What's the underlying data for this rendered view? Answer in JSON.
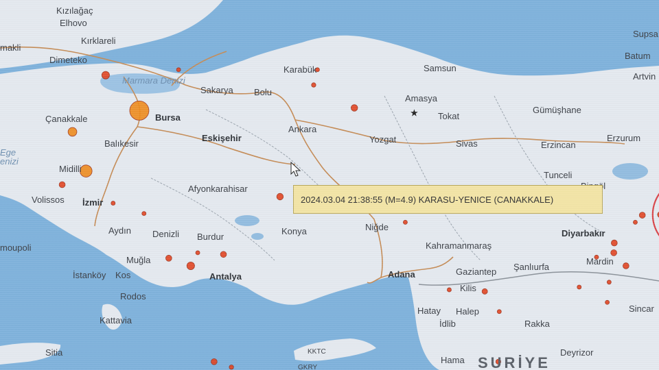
{
  "map": {
    "colors": {
      "sea": "#7fb2dc",
      "land": "#e5eaf0",
      "lake": "#93bde0",
      "road": "#c58b55",
      "border": "#9aa3ad",
      "quake_fill": "#e2421f",
      "quake_large": "#f08a1a",
      "quake_ring": "#d7262a"
    },
    "labels": [
      {
        "id": "kizilagac",
        "text": "Kızılağaç"
      },
      {
        "id": "elhovo",
        "text": "Elhovo"
      },
      {
        "id": "kirklareli",
        "text": "Kırklareli"
      },
      {
        "id": "makli",
        "text": "makli"
      },
      {
        "id": "dimeteko",
        "text": "Dimeteko"
      },
      {
        "id": "marmara",
        "text": "Marmara Denizi"
      },
      {
        "id": "sakarya",
        "text": "Sakarya"
      },
      {
        "id": "bolu",
        "text": "Bolu"
      },
      {
        "id": "karabuk",
        "text": "Karabük"
      },
      {
        "id": "samsun",
        "text": "Samsun"
      },
      {
        "id": "supsa",
        "text": "Supsa"
      },
      {
        "id": "batum",
        "text": "Batum"
      },
      {
        "id": "artvin",
        "text": "Artvin"
      },
      {
        "id": "amasya",
        "text": "Amasya"
      },
      {
        "id": "gumushane",
        "text": "Gümüşhane"
      },
      {
        "id": "canakkale",
        "text": "Çanakkale"
      },
      {
        "id": "bursa",
        "text": "Bursa"
      },
      {
        "id": "tokat",
        "text": "Tokat"
      },
      {
        "id": "ankara",
        "text": "Ankara"
      },
      {
        "id": "balikesir",
        "text": "Balıkesir"
      },
      {
        "id": "eskisehir",
        "text": "Eskişehir"
      },
      {
        "id": "yozgat",
        "text": "Yozgat"
      },
      {
        "id": "sivas",
        "text": "Sivas"
      },
      {
        "id": "erzincan",
        "text": "Erzincan"
      },
      {
        "id": "erzurum",
        "text": "Erzurum"
      },
      {
        "id": "ege",
        "text": "Ege"
      },
      {
        "id": "denizi",
        "text": "enizi"
      },
      {
        "id": "midilli",
        "text": "Midilli"
      },
      {
        "id": "tunceli",
        "text": "Tunceli"
      },
      {
        "id": "bingol",
        "text": "Bingöl"
      },
      {
        "id": "afyon",
        "text": "Afyonkarahisar"
      },
      {
        "id": "volissos",
        "text": "Volissos"
      },
      {
        "id": "izmir",
        "text": "İzmir"
      },
      {
        "id": "nigde",
        "text": "Niğde"
      },
      {
        "id": "aydin",
        "text": "Aydın"
      },
      {
        "id": "denizli",
        "text": "Denizli"
      },
      {
        "id": "burdur",
        "text": "Burdur"
      },
      {
        "id": "konya",
        "text": "Konya"
      },
      {
        "id": "diyarbakir",
        "text": "Diyarbakır"
      },
      {
        "id": "kahramanmaras",
        "text": "Kahramanmaraş"
      },
      {
        "id": "moupoli",
        "text": "moupoli"
      },
      {
        "id": "mardin",
        "text": "Mardin"
      },
      {
        "id": "sanliurfa",
        "text": "Şanlıurfa"
      },
      {
        "id": "mugla",
        "text": "Muğla"
      },
      {
        "id": "gaziantep",
        "text": "Gaziantep"
      },
      {
        "id": "istankoy",
        "text": "İstanköy"
      },
      {
        "id": "kos",
        "text": "Kos"
      },
      {
        "id": "antalya",
        "text": "Antalya"
      },
      {
        "id": "adana",
        "text": "Adana"
      },
      {
        "id": "kilis",
        "text": "Kilis"
      },
      {
        "id": "rodos",
        "text": "Rodos"
      },
      {
        "id": "sincar",
        "text": "Sincar"
      },
      {
        "id": "hatay",
        "text": "Hatay"
      },
      {
        "id": "halep",
        "text": "Halep"
      },
      {
        "id": "kattavia",
        "text": "Kattavia"
      },
      {
        "id": "idlib",
        "text": "İdlib"
      },
      {
        "id": "rakka",
        "text": "Rakka"
      },
      {
        "id": "sitia",
        "text": "Sitia"
      },
      {
        "id": "kktc",
        "text": "KKTC"
      },
      {
        "id": "gkry",
        "text": "GKRY"
      },
      {
        "id": "hama",
        "text": "Hama"
      },
      {
        "id": "suriye",
        "text": "SURİYE"
      },
      {
        "id": "deyrizor",
        "text": "Deyrizor"
      }
    ],
    "earthquakes": [
      {
        "lat": 40.62,
        "lon": 26.26,
        "mag": 2.8
      },
      {
        "lat": 39.97,
        "lon": 26.98,
        "mag": 4.9,
        "selected": true
      },
      {
        "lat": 40.72,
        "lon": 27.82,
        "mag": 2.0
      },
      {
        "lat": 39.58,
        "lon": 25.55,
        "mag": 3.0
      },
      {
        "lat": 38.86,
        "lon": 25.84,
        "mag": 3.6
      },
      {
        "lat": 38.61,
        "lon": 25.33,
        "mag": 2.5
      },
      {
        "lat": 38.27,
        "lon": 26.42,
        "mag": 2.0
      },
      {
        "lat": 38.08,
        "lon": 27.08,
        "mag": 2.0
      },
      {
        "lat": 37.26,
        "lon": 27.61,
        "mag": 2.5
      },
      {
        "lat": 37.12,
        "lon": 28.08,
        "mag": 2.8
      },
      {
        "lat": 37.36,
        "lon": 28.23,
        "mag": 2.0
      },
      {
        "lat": 37.33,
        "lon": 28.78,
        "mag": 2.5
      },
      {
        "lat": 38.39,
        "lon": 29.99,
        "mag": 2.6
      },
      {
        "lat": 40.44,
        "lon": 30.71,
        "mag": 2.2
      },
      {
        "lat": 40.72,
        "lon": 30.79,
        "mag": 2.0
      },
      {
        "lat": 40.02,
        "lon": 31.58,
        "mag": 2.6
      },
      {
        "lat": 37.92,
        "lon": 32.67,
        "mag": 2.0
      },
      {
        "lat": 36.68,
        "lon": 33.61,
        "mag": 2.0
      },
      {
        "lat": 36.65,
        "lon": 34.37,
        "mag": 2.4
      },
      {
        "lat": 36.28,
        "lon": 34.68,
        "mag": 2.0
      },
      {
        "lat": 35.36,
        "lon": 34.66,
        "mag": 2.3
      },
      {
        "lat": 35.07,
        "lon": 31.65,
        "mag": 3.0
      },
      {
        "lat": 35.26,
        "lon": 28.95,
        "mag": 2.2
      },
      {
        "lat": 35.36,
        "lon": 28.58,
        "mag": 2.5
      },
      {
        "lat": 37.28,
        "lon": 36.76,
        "mag": 2.0
      },
      {
        "lat": 37.36,
        "lon": 37.13,
        "mag": 2.5
      },
      {
        "lat": 37.54,
        "lon": 37.14,
        "mag": 2.5
      },
      {
        "lat": 37.12,
        "lon": 37.39,
        "mag": 2.5
      },
      {
        "lat": 36.82,
        "lon": 37.03,
        "mag": 2.0
      },
      {
        "lat": 36.45,
        "lon": 36.99,
        "mag": 2.0
      },
      {
        "lat": 36.73,
        "lon": 36.39,
        "mag": 2.0
      },
      {
        "lat": 37.92,
        "lon": 37.59,
        "mag": 2.0
      },
      {
        "lat": 38.05,
        "lon": 37.74,
        "mag": 2.5
      },
      {
        "lat": 38.06,
        "lon": 38.13,
        "mag": 2.5
      },
      {
        "lat": 37.87,
        "lon": 38.43,
        "mag": 3.2
      },
      {
        "lat": 38.05,
        "lon": 39.09,
        "mag": 2.0
      },
      {
        "lat": 37.57,
        "lon": 38.39,
        "mag": 2.0
      },
      {
        "lat": 37.93,
        "lon": 39.38,
        "mag": 2.2
      },
      {
        "lat": 39.76,
        "lon": 40.34,
        "mag": 2.3
      },
      {
        "lat": 39.62,
        "lon": 41.44,
        "mag": 2.0
      }
    ],
    "rings": [
      {
        "lat": 38.06,
        "lon": 38.74,
        "rings": [
          1,
          2,
          3
        ]
      }
    ],
    "capital_star": {
      "lat": 39.93,
      "lon": 32.86
    },
    "tooltip_text": "2024.03.04 21:38:55 (M=4.9) KARASU-YENICE (CANAKKALE)"
  }
}
